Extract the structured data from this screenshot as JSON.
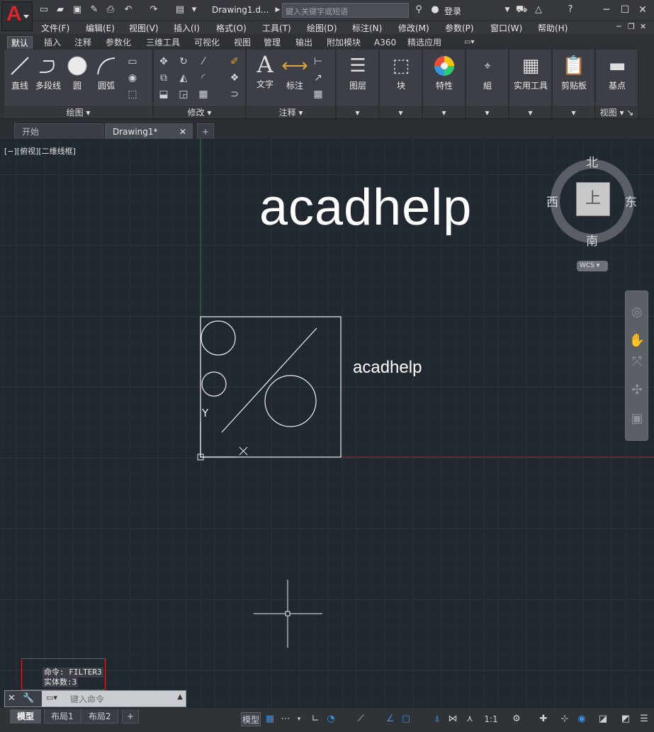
{
  "title_bar": {
    "doc_title": "Drawing1.d...",
    "search_placeholder": "键入关键字或短语",
    "login": "登录"
  },
  "menu": [
    "文件(F)",
    "编辑(E)",
    "视图(V)",
    "插入(I)",
    "格式(O)",
    "工具(T)",
    "绘图(D)",
    "标注(N)",
    "修改(M)",
    "参数(P)",
    "窗口(W)",
    "帮助(H)"
  ],
  "ribbon_tabs": [
    "默认",
    "插入",
    "注释",
    "参数化",
    "三维工具",
    "可视化",
    "视图",
    "管理",
    "输出",
    "附加模块",
    "A360",
    "精选应用"
  ],
  "ribbon": {
    "draw": {
      "line": "直线",
      "polyline": "多段线",
      "circle": "圆",
      "arc": "圆弧",
      "label": "绘图"
    },
    "modify": {
      "label": "修改"
    },
    "annotation": {
      "text": "文字",
      "dimension": "标注",
      "label": "注释"
    },
    "layers": "图层",
    "block": "块",
    "properties": "特性",
    "group": "組",
    "utilities": "实用工具",
    "clipboard": "剪贴板",
    "base": "基点",
    "view": "视图"
  },
  "doc_tabs": [
    "开始",
    "Drawing1*"
  ],
  "canvas": {
    "view_label": "[−][俯视][二维线框]",
    "big_text": "acadhelp",
    "small_text": "acadhelp",
    "ucs_y": "Y",
    "ucs_x": "X"
  },
  "viewcube": {
    "north": "北",
    "south": "南",
    "east": "东",
    "west": "西",
    "face": "上",
    "wcs": "WCS"
  },
  "command": {
    "history": [
      "命令: FILTER3",
      "实体数:3"
    ],
    "placeholder": "键入命令"
  },
  "layout_tabs": [
    "模型",
    "布局1",
    "布局2"
  ],
  "status": {
    "model": "模型",
    "scale": "1:1"
  },
  "colors": {
    "canvas": "#212830",
    "accent": "#d8262a",
    "highlight_box": "#d62a2a"
  }
}
